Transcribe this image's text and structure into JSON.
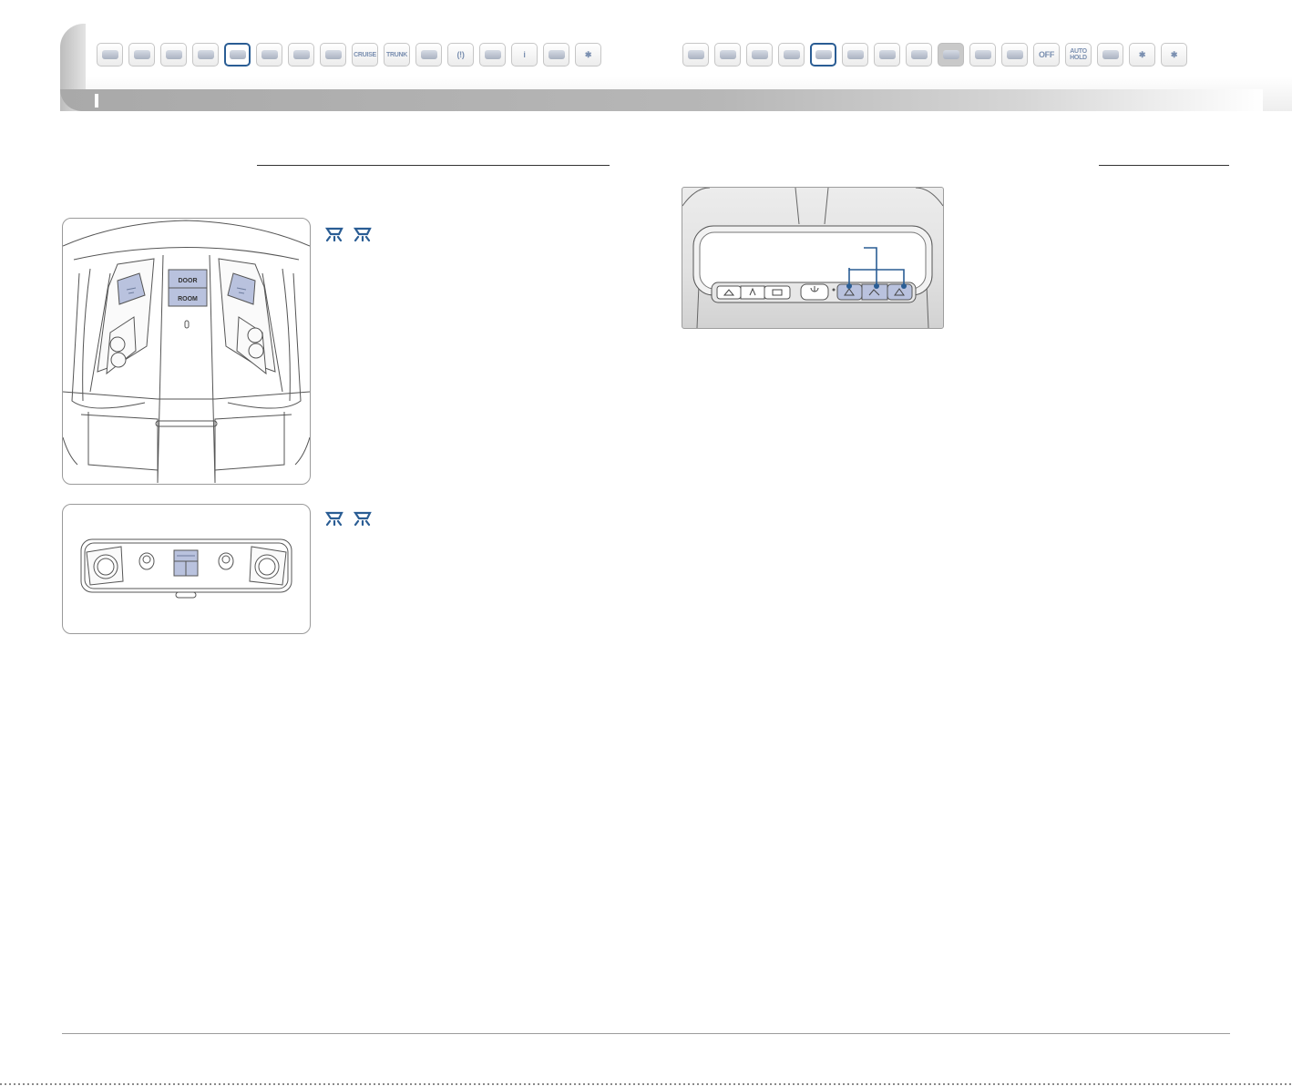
{
  "header": {
    "left_icons": [
      {
        "name": "remote-key-icon",
        "text": ""
      },
      {
        "name": "smart-key-icon",
        "text": ""
      },
      {
        "name": "fob-icon",
        "text": ""
      },
      {
        "name": "key-blade-icon",
        "text": ""
      },
      {
        "name": "overhead-lamp-icon",
        "text": "",
        "active": true
      },
      {
        "name": "mirror-switch-icon",
        "text": ""
      },
      {
        "name": "seat-switch-icon",
        "text": ""
      },
      {
        "name": "wiper-icon",
        "text": ""
      },
      {
        "name": "cruise-icon",
        "text": "CRUISE"
      },
      {
        "name": "trunk-icon",
        "text": "TRUNK"
      },
      {
        "name": "window-switch-icon",
        "text": ""
      },
      {
        "name": "tpms-icon",
        "text": "(!)"
      },
      {
        "name": "display-icon",
        "text": ""
      },
      {
        "name": "info-icon",
        "text": "i"
      },
      {
        "name": "climate-icon",
        "text": ""
      },
      {
        "name": "bluetooth-icon",
        "text": "✱"
      }
    ],
    "right_icons": [
      {
        "name": "voice-icon",
        "text": ""
      },
      {
        "name": "steering-icon",
        "text": ""
      },
      {
        "name": "lever-icon",
        "text": ""
      },
      {
        "name": "console-icon",
        "text": ""
      },
      {
        "name": "homelink-icon",
        "text": "",
        "active": true
      },
      {
        "name": "switch-bank-icon",
        "text": ""
      },
      {
        "name": "switch-bank-2-icon",
        "text": ""
      },
      {
        "name": "grid-panel-icon",
        "text": ""
      },
      {
        "name": "blank-panel-icon",
        "text": "",
        "dim": true
      },
      {
        "name": "media-panel-icon",
        "text": ""
      },
      {
        "name": "shifter-icon",
        "text": ""
      },
      {
        "name": "esc-off-icon",
        "text": "OFF"
      },
      {
        "name": "auto-hold-icon",
        "text": "AUTO HOLD"
      },
      {
        "name": "seat-icon",
        "text": ""
      },
      {
        "name": "bluetooth-icon-2",
        "text": "✱"
      },
      {
        "name": "bluetooth-icon-3",
        "text": "✱"
      }
    ]
  },
  "overhead_console": {
    "door_label": "DOOR",
    "room_label": "ROOM"
  },
  "colors": {
    "accent_blue": "#2a5d94",
    "button_blue": "#b9c2de",
    "line_gray": "#555555"
  }
}
